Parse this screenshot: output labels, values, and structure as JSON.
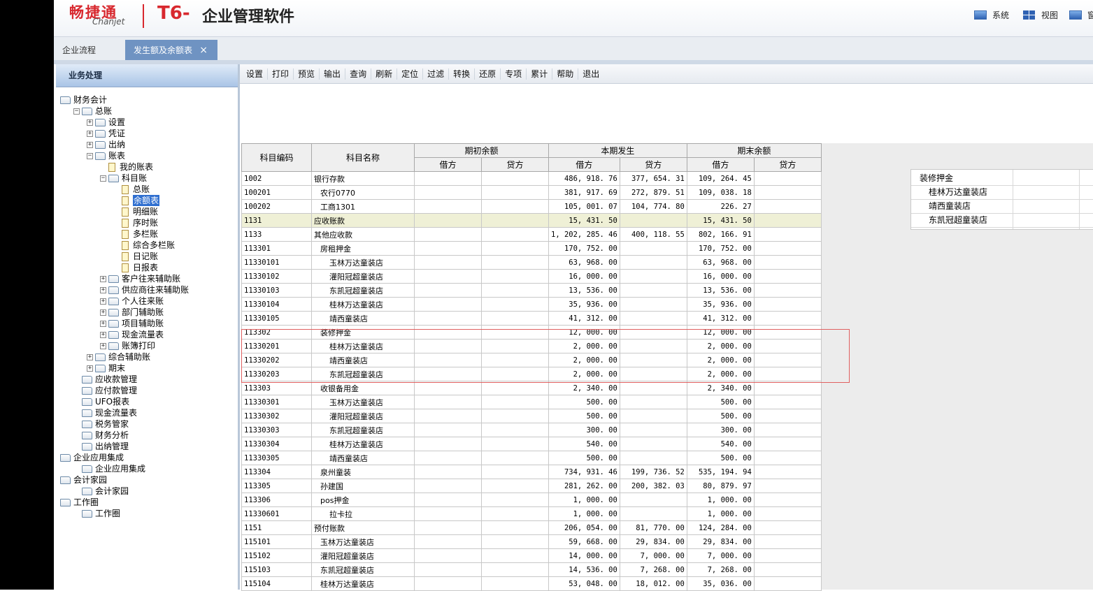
{
  "header": {
    "logo_cn": "畅捷通",
    "logo_en": "Chanjet",
    "product_t6": "T6-",
    "product_name": "企业管理软件",
    "buttons": [
      {
        "label": "系统",
        "icon": "monitor-icon"
      },
      {
        "label": "视图",
        "icon": "grid-icon"
      },
      {
        "label": "窗",
        "icon": "window-icon"
      }
    ]
  },
  "tabs": [
    {
      "label": "企业流程",
      "active": false
    },
    {
      "label": "发生额及余额表",
      "active": true,
      "close": "×"
    }
  ],
  "sidebar": {
    "title": "业务处理",
    "tree": [
      {
        "label": "财务会计",
        "level": 0,
        "toggle": "",
        "kind": "folder"
      },
      {
        "label": "总账",
        "level": 1,
        "toggle": "−",
        "kind": "folder"
      },
      {
        "label": "设置",
        "level": 2,
        "toggle": "+",
        "kind": "folder"
      },
      {
        "label": "凭证",
        "level": 2,
        "toggle": "+",
        "kind": "folder"
      },
      {
        "label": "出纳",
        "level": 2,
        "toggle": "+",
        "kind": "folder"
      },
      {
        "label": "账表",
        "level": 2,
        "toggle": "−",
        "kind": "folder"
      },
      {
        "label": "我的账表",
        "level": 3,
        "toggle": "",
        "kind": "page"
      },
      {
        "label": "科目账",
        "level": 3,
        "toggle": "−",
        "kind": "folder"
      },
      {
        "label": "总账",
        "level": 4,
        "toggle": "",
        "kind": "page"
      },
      {
        "label": "余额表",
        "level": 4,
        "toggle": "",
        "kind": "page",
        "selected": true
      },
      {
        "label": "明细账",
        "level": 4,
        "toggle": "",
        "kind": "page"
      },
      {
        "label": "序时账",
        "level": 4,
        "toggle": "",
        "kind": "page"
      },
      {
        "label": "多栏账",
        "level": 4,
        "toggle": "",
        "kind": "page"
      },
      {
        "label": "综合多栏账",
        "level": 4,
        "toggle": "",
        "kind": "page"
      },
      {
        "label": "日记账",
        "level": 4,
        "toggle": "",
        "kind": "page"
      },
      {
        "label": "日报表",
        "level": 4,
        "toggle": "",
        "kind": "page"
      },
      {
        "label": "客户往来辅助账",
        "level": 3,
        "toggle": "+",
        "kind": "folder"
      },
      {
        "label": "供应商往来辅助账",
        "level": 3,
        "toggle": "+",
        "kind": "folder"
      },
      {
        "label": "个人往来账",
        "level": 3,
        "toggle": "+",
        "kind": "folder"
      },
      {
        "label": "部门辅助账",
        "level": 3,
        "toggle": "+",
        "kind": "folder"
      },
      {
        "label": "项目辅助账",
        "level": 3,
        "toggle": "+",
        "kind": "folder"
      },
      {
        "label": "现金流量表",
        "level": 3,
        "toggle": "+",
        "kind": "folder"
      },
      {
        "label": "账簿打印",
        "level": 3,
        "toggle": "+",
        "kind": "folder"
      },
      {
        "label": "综合辅助账",
        "level": 2,
        "toggle": "+",
        "kind": "folder"
      },
      {
        "label": "期末",
        "level": 2,
        "toggle": "+",
        "kind": "folder"
      },
      {
        "label": "应收款管理",
        "level": 1,
        "toggle": "",
        "kind": "folder"
      },
      {
        "label": "应付款管理",
        "level": 1,
        "toggle": "",
        "kind": "folder"
      },
      {
        "label": "UFO报表",
        "level": 1,
        "toggle": "",
        "kind": "folder"
      },
      {
        "label": "现金流量表",
        "level": 1,
        "toggle": "",
        "kind": "folder"
      },
      {
        "label": "税务管家",
        "level": 1,
        "toggle": "",
        "kind": "folder"
      },
      {
        "label": "财务分析",
        "level": 1,
        "toggle": "",
        "kind": "folder"
      },
      {
        "label": "出纳管理",
        "level": 1,
        "toggle": "",
        "kind": "folder"
      },
      {
        "label": "企业应用集成",
        "level": 0,
        "toggle": "",
        "kind": "folder"
      },
      {
        "label": "企业应用集成",
        "level": 1,
        "toggle": "",
        "kind": "folder"
      },
      {
        "label": "会计家园",
        "level": 0,
        "toggle": "",
        "kind": "folder"
      },
      {
        "label": "会计家园",
        "level": 1,
        "toggle": "",
        "kind": "folder"
      },
      {
        "label": "工作圈",
        "level": 0,
        "toggle": "",
        "kind": "folder"
      },
      {
        "label": "工作圈",
        "level": 1,
        "toggle": "",
        "kind": "folder"
      }
    ]
  },
  "toolbar": [
    "设置",
    "打印",
    "预览",
    "输出",
    "查询",
    "刷新",
    "定位",
    "过滤",
    "转换",
    "还原",
    "专项",
    "累计",
    "帮助",
    "退出"
  ],
  "table": {
    "headers": {
      "code": "科目编码",
      "name": "科目名称",
      "groups": [
        "期初余额",
        "本期发生",
        "期末余额"
      ],
      "sub": [
        "借方",
        "贷方",
        "借方",
        "贷方",
        "借方",
        "贷方"
      ]
    },
    "rows": [
      {
        "code": "1002",
        "name": "银行存款",
        "indent": 0,
        "bd": "",
        "bc": "",
        "pd": "486, 918. 76",
        "pc": "377, 654. 31",
        "ed": "109, 264. 45",
        "ec": ""
      },
      {
        "code": "100201",
        "name": "农行0770",
        "indent": 1,
        "bd": "",
        "bc": "",
        "pd": "381, 917. 69",
        "pc": "272, 879. 51",
        "ed": "109, 038. 18",
        "ec": ""
      },
      {
        "code": "100202",
        "name": "工商1301",
        "indent": 1,
        "bd": "",
        "bc": "",
        "pd": "105, 001. 07",
        "pc": "104, 774. 80",
        "ed": "226. 27",
        "ec": ""
      },
      {
        "code": "1131",
        "name": "应收账款",
        "indent": 0,
        "bd": "",
        "bc": "",
        "pd": "15, 431. 50",
        "pc": "",
        "ed": "15, 431. 50",
        "ec": "",
        "highlight": true
      },
      {
        "code": "1133",
        "name": "其他应收款",
        "indent": 0,
        "bd": "",
        "bc": "",
        "pd": "1, 202, 285. 46",
        "pc": "400, 118. 55",
        "ed": "802, 166. 91",
        "ec": ""
      },
      {
        "code": "113301",
        "name": "房租押金",
        "indent": 1,
        "bd": "",
        "bc": "",
        "pd": "170, 752. 00",
        "pc": "",
        "ed": "170, 752. 00",
        "ec": ""
      },
      {
        "code": "11330101",
        "name": "玉林万达童装店",
        "indent": 2,
        "bd": "",
        "bc": "",
        "pd": "63, 968. 00",
        "pc": "",
        "ed": "63, 968. 00",
        "ec": ""
      },
      {
        "code": "11330102",
        "name": "灌阳冠超童装店",
        "indent": 2,
        "bd": "",
        "bc": "",
        "pd": "16, 000. 00",
        "pc": "",
        "ed": "16, 000. 00",
        "ec": ""
      },
      {
        "code": "11330103",
        "name": "东凯冠超童装店",
        "indent": 2,
        "bd": "",
        "bc": "",
        "pd": "13, 536. 00",
        "pc": "",
        "ed": "13, 536. 00",
        "ec": ""
      },
      {
        "code": "11330104",
        "name": "桂林万达童装店",
        "indent": 2,
        "bd": "",
        "bc": "",
        "pd": "35, 936. 00",
        "pc": "",
        "ed": "35, 936. 00",
        "ec": ""
      },
      {
        "code": "11330105",
        "name": "靖西童装店",
        "indent": 2,
        "bd": "",
        "bc": "",
        "pd": "41, 312. 00",
        "pc": "",
        "ed": "41, 312. 00",
        "ec": ""
      },
      {
        "code": "113302",
        "name": "装修押金",
        "indent": 1,
        "bd": "",
        "bc": "",
        "pd": "12, 000. 00",
        "pc": "",
        "ed": "12, 000. 00",
        "ec": ""
      },
      {
        "code": "11330201",
        "name": "桂林万达童装店",
        "indent": 2,
        "bd": "",
        "bc": "",
        "pd": "2, 000. 00",
        "pc": "",
        "ed": "2, 000. 00",
        "ec": ""
      },
      {
        "code": "11330202",
        "name": "靖西童装店",
        "indent": 2,
        "bd": "",
        "bc": "",
        "pd": "2, 000. 00",
        "pc": "",
        "ed": "2, 000. 00",
        "ec": ""
      },
      {
        "code": "11330203",
        "name": "东凯冠超童装店",
        "indent": 2,
        "bd": "",
        "bc": "",
        "pd": "2, 000. 00",
        "pc": "",
        "ed": "2, 000. 00",
        "ec": ""
      },
      {
        "code": "113303",
        "name": "收银备用金",
        "indent": 1,
        "bd": "",
        "bc": "",
        "pd": "2, 340. 00",
        "pc": "",
        "ed": "2, 340. 00",
        "ec": ""
      },
      {
        "code": "11330301",
        "name": "玉林万达童装店",
        "indent": 2,
        "bd": "",
        "bc": "",
        "pd": "500. 00",
        "pc": "",
        "ed": "500. 00",
        "ec": ""
      },
      {
        "code": "11330302",
        "name": "灌阳冠超童装店",
        "indent": 2,
        "bd": "",
        "bc": "",
        "pd": "500. 00",
        "pc": "",
        "ed": "500. 00",
        "ec": ""
      },
      {
        "code": "11330303",
        "name": "东凯冠超童装店",
        "indent": 2,
        "bd": "",
        "bc": "",
        "pd": "300. 00",
        "pc": "",
        "ed": "300. 00",
        "ec": ""
      },
      {
        "code": "11330304",
        "name": "桂林万达童装店",
        "indent": 2,
        "bd": "",
        "bc": "",
        "pd": "540. 00",
        "pc": "",
        "ed": "540. 00",
        "ec": ""
      },
      {
        "code": "11330305",
        "name": "靖西童装店",
        "indent": 2,
        "bd": "",
        "bc": "",
        "pd": "500. 00",
        "pc": "",
        "ed": "500. 00",
        "ec": ""
      },
      {
        "code": "113304",
        "name": "泉州童装",
        "indent": 1,
        "bd": "",
        "bc": "",
        "pd": "734, 931. 46",
        "pc": "199, 736. 52",
        "ed": "535, 194. 94",
        "ec": ""
      },
      {
        "code": "113305",
        "name": "孙建国",
        "indent": 1,
        "bd": "",
        "bc": "",
        "pd": "281, 262. 00",
        "pc": "200, 382. 03",
        "ed": "80, 879. 97",
        "ec": ""
      },
      {
        "code": "113306",
        "name": "pos押金",
        "indent": 1,
        "bd": "",
        "bc": "",
        "pd": "1, 000. 00",
        "pc": "",
        "ed": "1, 000. 00",
        "ec": ""
      },
      {
        "code": "11330601",
        "name": "拉卡拉",
        "indent": 2,
        "bd": "",
        "bc": "",
        "pd": "1, 000. 00",
        "pc": "",
        "ed": "1, 000. 00",
        "ec": ""
      },
      {
        "code": "1151",
        "name": "预付账款",
        "indent": 0,
        "bd": "",
        "bc": "",
        "pd": "206, 054. 00",
        "pc": "81, 770. 00",
        "ed": "124, 284. 00",
        "ec": ""
      },
      {
        "code": "115101",
        "name": "玉林万达童装店",
        "indent": 1,
        "bd": "",
        "bc": "",
        "pd": "59, 668. 00",
        "pc": "29, 834. 00",
        "ed": "29, 834. 00",
        "ec": ""
      },
      {
        "code": "115102",
        "name": "灌阳冠超童装店",
        "indent": 1,
        "bd": "",
        "bc": "",
        "pd": "14, 000. 00",
        "pc": "7, 000. 00",
        "ed": "7, 000. 00",
        "ec": ""
      },
      {
        "code": "115103",
        "name": "东凯冠超童装店",
        "indent": 1,
        "bd": "",
        "bc": "",
        "pd": "14, 536. 00",
        "pc": "7, 268. 00",
        "ed": "7, 268. 00",
        "ec": ""
      },
      {
        "code": "115104",
        "name": "桂林万达童装店",
        "indent": 1,
        "bd": "",
        "bc": "",
        "pd": "53, 048. 00",
        "pc": "18, 012. 00",
        "ed": "35, 036. 00",
        "ec": ""
      }
    ]
  },
  "popup": {
    "rows": [
      "装修押金",
      "桂林万达童装店",
      "靖西童装店",
      "东凯冠超童装店"
    ]
  }
}
